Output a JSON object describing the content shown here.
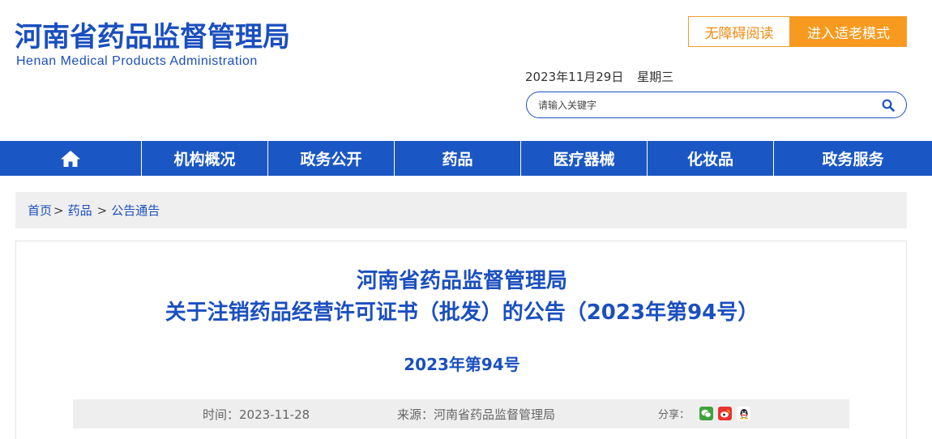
{
  "header": {
    "logo_cn": "河南省药品监督管理局",
    "logo_en": "Henan Medical Products Administration",
    "btn_accessible": "无障碍阅读",
    "btn_elder": "进入适老模式",
    "date": "2023年11月29日",
    "weekday": "星期三",
    "search_placeholder": "请输入关键字"
  },
  "nav": {
    "home_icon": "home-icon",
    "items": [
      "机构概况",
      "政务公开",
      "药品",
      "医疗器械",
      "化妆品",
      "政务服务"
    ]
  },
  "breadcrumb": {
    "home": "首页",
    "sep": ">",
    "level1": "药品",
    "level2": "公告通告"
  },
  "article": {
    "title_line1": "河南省药品监督管理局",
    "title_line2": "关于注销药品经营许可证书（批发）的公告（2023年第94号）",
    "doc_number": "2023年第94号",
    "time": "时间：2023-11-28",
    "source": "来源：河南省药品监督管理局",
    "share_label": "分享：",
    "share_icons": [
      "wechat-icon",
      "weibo-icon",
      "qq-icon"
    ]
  },
  "colors": {
    "brand_blue": "#1b57c4",
    "accent_orange": "#f79a1f"
  }
}
